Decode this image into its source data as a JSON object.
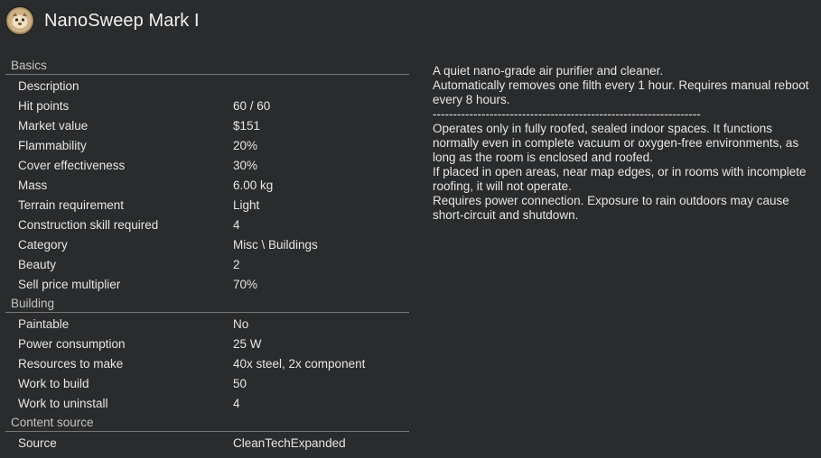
{
  "header": {
    "title": "NanoSweep Mark I",
    "icon": "nanosweep-portrait-icon"
  },
  "sections": [
    {
      "title": "Basics",
      "rows": [
        {
          "label": "Description",
          "value": ""
        },
        {
          "label": "Hit points",
          "value": "60 / 60"
        },
        {
          "label": "Market value",
          "value": "$151"
        },
        {
          "label": "Flammability",
          "value": "20%"
        },
        {
          "label": "Cover effectiveness",
          "value": "30%"
        },
        {
          "label": "Mass",
          "value": "6.00 kg"
        },
        {
          "label": "Terrain requirement",
          "value": "Light"
        },
        {
          "label": "Construction skill required",
          "value": "4"
        },
        {
          "label": "Category",
          "value": "Misc \\ Buildings"
        },
        {
          "label": "Beauty",
          "value": "2"
        },
        {
          "label": "Sell price multiplier",
          "value": "70%"
        }
      ]
    },
    {
      "title": "Building",
      "rows": [
        {
          "label": "Paintable",
          "value": "No"
        },
        {
          "label": "Power consumption",
          "value": "25 W"
        },
        {
          "label": "Resources to make",
          "value": "40x steel, 2x component"
        },
        {
          "label": "Work to build",
          "value": "50"
        },
        {
          "label": "Work to uninstall",
          "value": "4"
        }
      ]
    },
    {
      "title": "Content source",
      "rows": [
        {
          "label": "Source",
          "value": "CleanTechExpanded"
        }
      ]
    }
  ],
  "description": {
    "lines": [
      "A quiet nano-grade air purifier and cleaner.",
      "Automatically removes one filth every 1 hour. Requires manual reboot every 8 hours.",
      "------------------------------------------------------------------",
      "Operates only in fully roofed, sealed indoor spaces. It functions normally even in complete vacuum or oxygen-free environments, as long as the room is enclosed and roofed.",
      "If placed in open areas, near map edges, or in rooms with incomplete roofing, it will not operate.",
      "Requires power connection. Exposure to rain outdoors may cause short-circuit and shutdown."
    ]
  }
}
